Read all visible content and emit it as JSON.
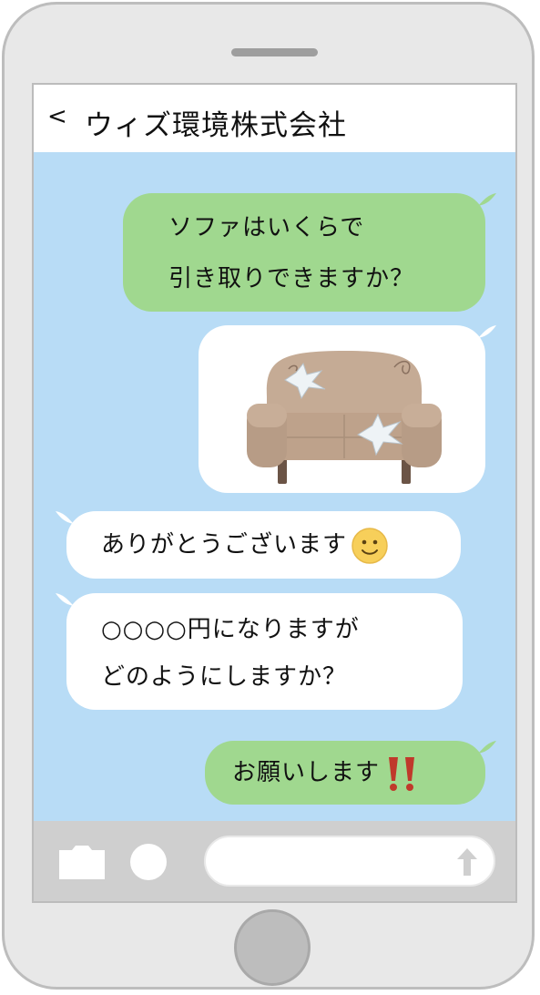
{
  "header": {
    "back_label": "<",
    "title": "ウィズ環境株式会社"
  },
  "messages": [
    {
      "side": "right",
      "color": "green",
      "lines": [
        "ソファはいくらで",
        "引き取りできますか？"
      ]
    },
    {
      "side": "right",
      "color": "white",
      "image": "damaged-sofa-image"
    },
    {
      "side": "left",
      "color": "white",
      "lines": [
        "ありがとうございます"
      ],
      "emoji": "smiling-face-icon"
    },
    {
      "side": "left",
      "color": "white",
      "lines": [
        "○○○○円になりますが",
        "どのようにしますか？"
      ]
    },
    {
      "side": "right",
      "color": "green",
      "lines": [
        "お願いします"
      ],
      "emoji": "double-exclamation-icon"
    }
  ],
  "input": {
    "placeholder": ""
  },
  "colors": {
    "chat_background": "#b8dcf6",
    "sent_bubble": "#a0d88f",
    "received_bubble": "#ffffff",
    "phone_body": "#e8e8e8"
  }
}
